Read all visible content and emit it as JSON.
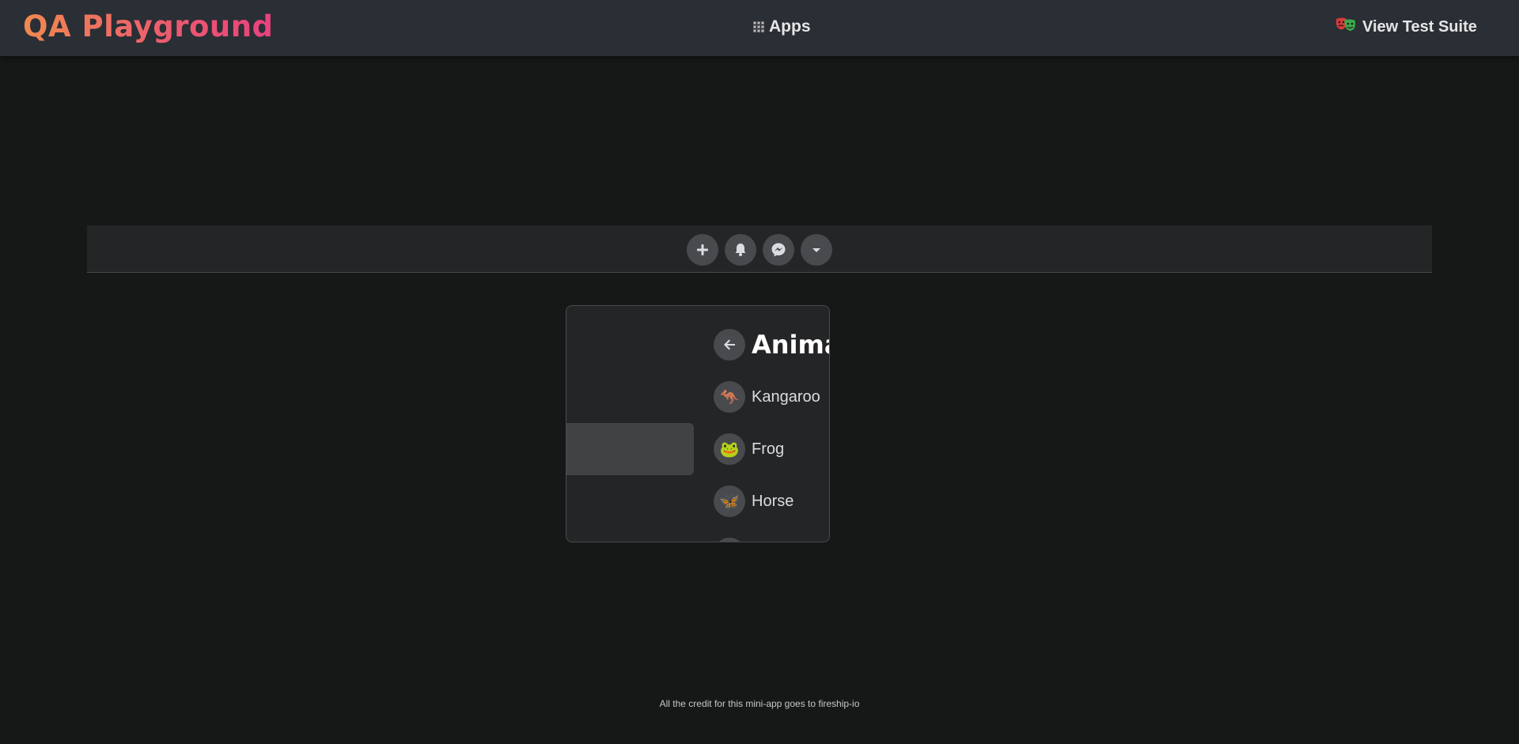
{
  "header": {
    "brand": "QA Playground",
    "apps_label": "Apps",
    "suite_label": "View Test Suite",
    "apps_icon": "grid-icon",
    "suite_icon": "theater-masks-icon"
  },
  "navbar": {
    "items": [
      {
        "icon": "plus-icon"
      },
      {
        "icon": "bell-icon"
      },
      {
        "icon": "messenger-icon"
      },
      {
        "icon": "caret-down-icon"
      }
    ]
  },
  "dropdown": {
    "title": "Animals",
    "back_icon": "arrow-left-icon",
    "items": [
      {
        "label": "Kangaroo",
        "icon": "🦘"
      },
      {
        "label": "Frog",
        "icon": "🐸"
      },
      {
        "label": "Horse",
        "icon": "🦋"
      }
    ]
  },
  "footer": {
    "credit": "All the credit for this mini-app goes to fireship-io"
  }
}
